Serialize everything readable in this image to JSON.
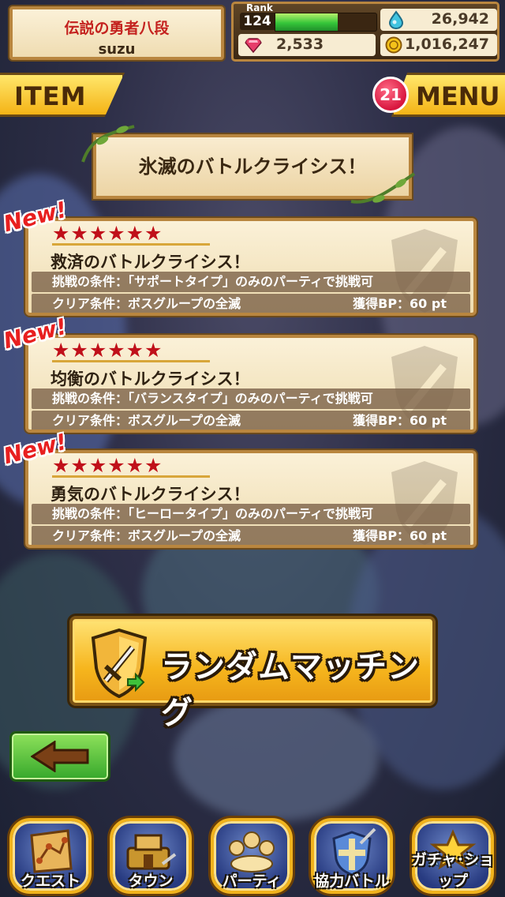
{
  "header": {
    "title": "伝説の勇者八段",
    "username": "suzu",
    "rank_label": "Rank",
    "rank": "124",
    "xp_progress": 0.62,
    "stamina": "26,942",
    "gems": "2,533",
    "coins": "1,016,247"
  },
  "top_buttons": {
    "item_label": "ITEM",
    "menu_label": "MENU",
    "menu_badge": "21"
  },
  "event_title": "氷滅のバトルクライシス！",
  "battles": [
    {
      "new_label": "New!",
      "stars": "★★★★★★",
      "title": "救済のバトルクライシス！",
      "challenge": "挑戦の条件：「サポートタイプ」のみのパーティで挑戦可",
      "clear": "クリア条件：ボスグループの全滅",
      "bp": "獲得BP：60 pt"
    },
    {
      "new_label": "New!",
      "stars": "★★★★★★",
      "title": "均衡のバトルクライシス！",
      "challenge": "挑戦の条件：「バランスタイプ」のみのパーティで挑戦可",
      "clear": "クリア条件：ボスグループの全滅",
      "bp": "獲得BP：60 pt"
    },
    {
      "new_label": "New!",
      "stars": "★★★★★★",
      "title": "勇気のバトルクライシス！",
      "challenge": "挑戦の条件：「ヒーロータイプ」のみのパーティで挑戦可",
      "clear": "クリア条件：ボスグループの全滅",
      "bp": "獲得BP：60 pt"
    }
  ],
  "random_matching_label": "ランダムマッチング",
  "nav": [
    {
      "label": "クエスト",
      "icon": "map-icon"
    },
    {
      "label": "タウン",
      "icon": "town-icon"
    },
    {
      "label": "パーティ",
      "icon": "party-icon"
    },
    {
      "label": "協力バトル",
      "icon": "coop-battle-icon"
    },
    {
      "label": "ガチャ･ショップ",
      "icon": "gacha-shop-icon"
    }
  ],
  "colors": {
    "accent_gold": "#f4b316",
    "title_red": "#c4221f",
    "star_red": "#c0101a",
    "back_green": "#36a82b"
  }
}
